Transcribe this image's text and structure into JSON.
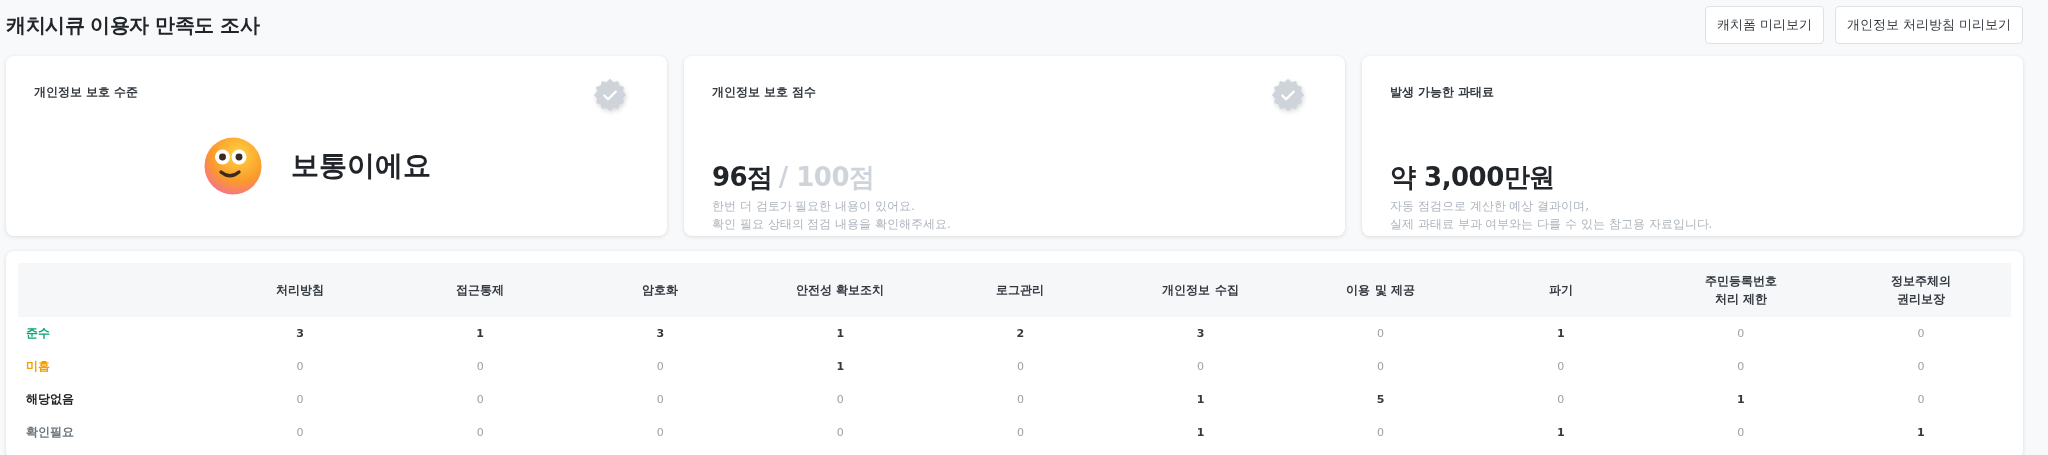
{
  "page": {
    "title": "캐치시큐 이용자 만족도 조사"
  },
  "buttons": [
    "캐치폼 미리보기",
    "개인정보 처리방침 미리보기"
  ],
  "cards": [
    {
      "kind": "level",
      "title": "개인정보 보호 수준",
      "badge": true,
      "value": "보통이에요"
    },
    {
      "kind": "score",
      "title": "개인정보 보호 점수",
      "badge": true,
      "score": "96점",
      "total": "/ 100점",
      "notes": [
        "한번 더 검토가 필요한 내용이 있어요.",
        "확인 필요 상태의 점검 내용을 확인해주세요."
      ]
    },
    {
      "kind": "fine",
      "title": "발생 가능한 과태료",
      "badge": false,
      "amount": "약 3,000만원",
      "notes": [
        "자동 점검으로 계산한 예상 결과이며,",
        "실제 과태료 부과 여부와는 다를 수 있는 참고용 자료입니다."
      ]
    }
  ],
  "table": {
    "columns": [
      "처리방침",
      "접근통제",
      "암호화",
      "안전성 확보조치",
      "로그관리",
      "개인정보 수집",
      "이용 및 제공",
      "파기",
      "주민등록번호\n처리 제한",
      "정보주체의\n권리보장"
    ],
    "rows": [
      {
        "label": "준수",
        "color": "#0ca678",
        "cells": [
          {
            "value": "3",
            "muted": false
          },
          {
            "value": "1",
            "muted": false
          },
          {
            "value": "3",
            "muted": false
          },
          {
            "value": "1",
            "muted": false
          },
          {
            "value": "2",
            "muted": false
          },
          {
            "value": "3",
            "muted": false
          },
          {
            "value": "0",
            "muted": true
          },
          {
            "value": "1",
            "muted": false
          },
          {
            "value": "0",
            "muted": true
          },
          {
            "value": "0",
            "muted": true
          }
        ]
      },
      {
        "label": "미흡",
        "color": "#f59f00",
        "cells": [
          {
            "value": "0",
            "muted": true
          },
          {
            "value": "0",
            "muted": true
          },
          {
            "value": "0",
            "muted": true
          },
          {
            "value": "1",
            "muted": false
          },
          {
            "value": "0",
            "muted": true
          },
          {
            "value": "0",
            "muted": true
          },
          {
            "value": "0",
            "muted": true
          },
          {
            "value": "0",
            "muted": true
          },
          {
            "value": "0",
            "muted": true
          },
          {
            "value": "0",
            "muted": true
          }
        ]
      },
      {
        "label": "해당없음",
        "color": "#212529",
        "cells": [
          {
            "value": "0",
            "muted": true
          },
          {
            "value": "0",
            "muted": true
          },
          {
            "value": "0",
            "muted": true
          },
          {
            "value": "0",
            "muted": true
          },
          {
            "value": "0",
            "muted": true
          },
          {
            "value": "1",
            "muted": false
          },
          {
            "value": "5",
            "muted": false
          },
          {
            "value": "0",
            "muted": true
          },
          {
            "value": "1",
            "muted": false
          },
          {
            "value": "0",
            "muted": true
          }
        ]
      },
      {
        "label": "확인필요",
        "color": "#6c757d",
        "cells": [
          {
            "value": "0",
            "muted": true
          },
          {
            "value": "0",
            "muted": true
          },
          {
            "value": "0",
            "muted": true
          },
          {
            "value": "0",
            "muted": true
          },
          {
            "value": "0",
            "muted": true
          },
          {
            "value": "1",
            "muted": false
          },
          {
            "value": "0",
            "muted": true
          },
          {
            "value": "1",
            "muted": false
          },
          {
            "value": "0",
            "muted": true
          },
          {
            "value": "1",
            "muted": false
          }
        ]
      }
    ]
  }
}
